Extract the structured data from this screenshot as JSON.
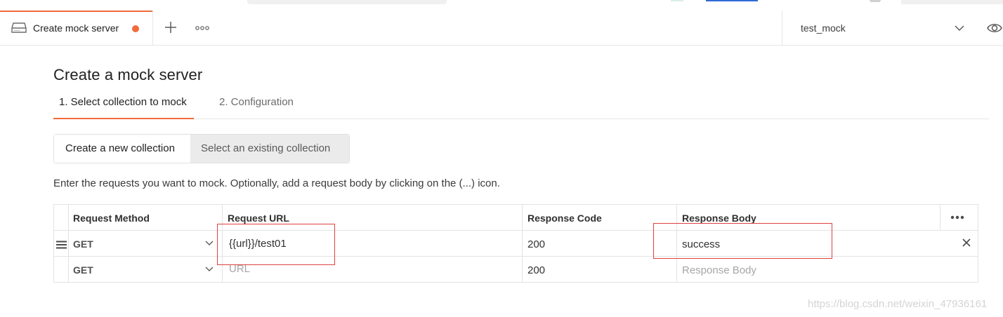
{
  "tabs": {
    "active_label": "Create mock server",
    "unsaved_color": "#f26b3a"
  },
  "environment": {
    "selected": "test_mock"
  },
  "page": {
    "title": "Create a mock server",
    "steps": [
      {
        "label": "1. Select collection to mock",
        "active": true
      },
      {
        "label": "2. Configuration",
        "active": false
      }
    ],
    "segmented": {
      "new_label": "Create a new collection",
      "existing_label": "Select an existing collection",
      "selected": "Create a new collection"
    },
    "instructions": "Enter the requests you want to mock. Optionally, add a request body by clicking on the (...) icon."
  },
  "table": {
    "headers": [
      "Request Method",
      "Request URL",
      "Response Code",
      "Response Body"
    ],
    "rows": [
      {
        "method": "GET",
        "url": "{{url}}/test01",
        "code": "200",
        "body": "success"
      },
      {
        "method": "GET",
        "url_placeholder": "URL",
        "code": "200",
        "body_placeholder": "Response Body"
      }
    ]
  },
  "watermark": "https://blog.csdn.net/weixin_47936161",
  "colors": {
    "accent": "#f26b3a",
    "highlight_box": "#e04040"
  }
}
